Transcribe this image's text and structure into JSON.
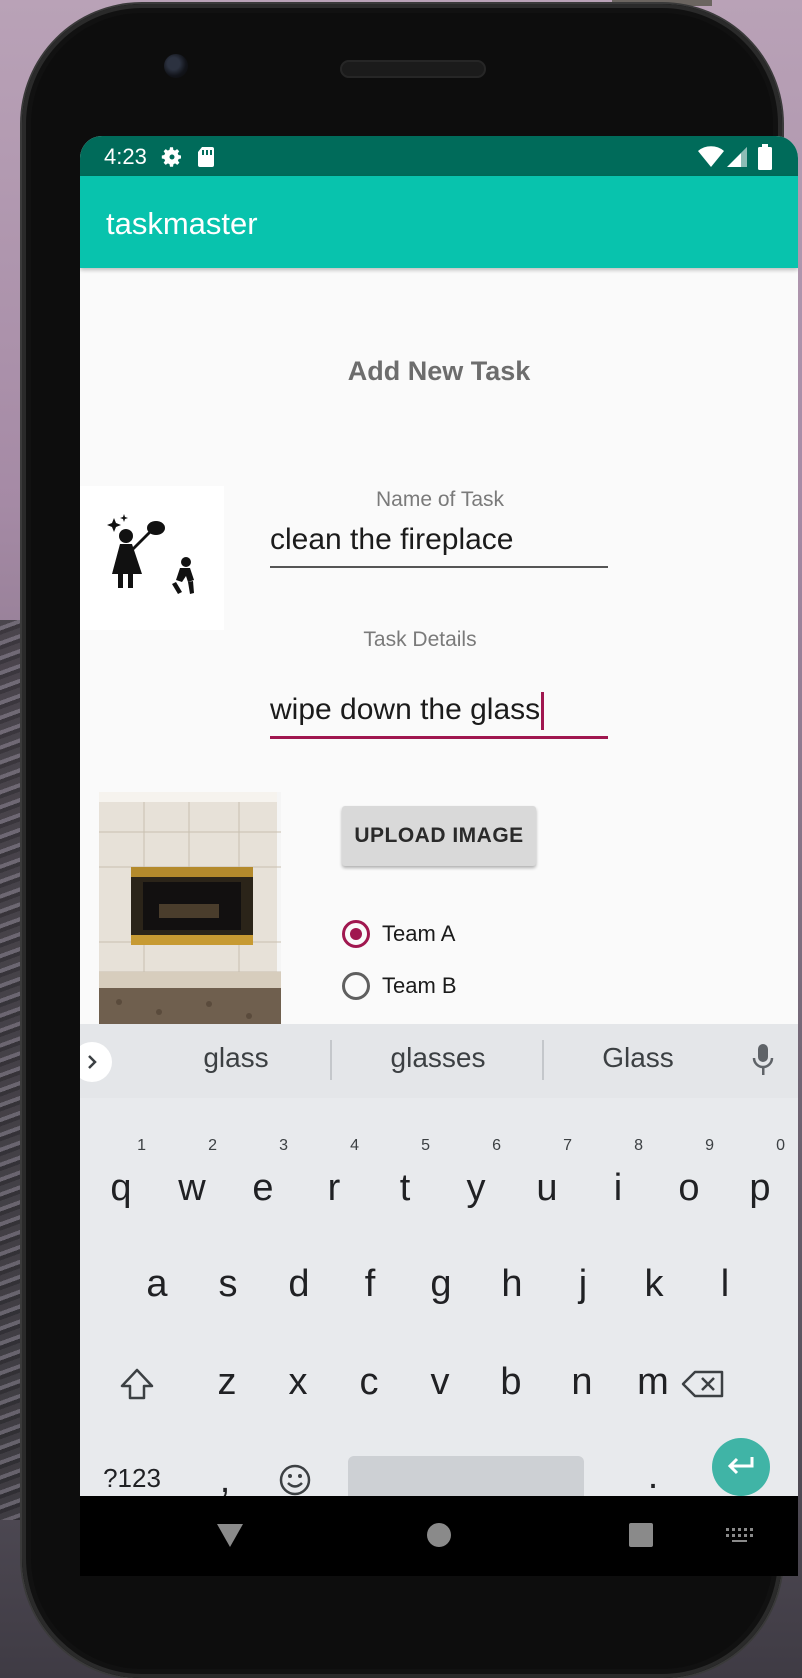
{
  "status": {
    "time": "4:23"
  },
  "app": {
    "title": "taskmaster"
  },
  "form": {
    "heading": "Add New Task",
    "name_label": "Name of Task",
    "name_value": "clean the fireplace",
    "details_label": "Task Details",
    "details_value": "wipe down the glass",
    "upload_button": "UPLOAD IMAGE",
    "teams": [
      {
        "label": "Team A",
        "checked": true
      },
      {
        "label": "Team B",
        "checked": false
      }
    ]
  },
  "keyboard": {
    "suggestions": [
      "glass",
      "glasses",
      "Glass"
    ],
    "row1": [
      {
        "key": "q",
        "hint": "1"
      },
      {
        "key": "w",
        "hint": "2"
      },
      {
        "key": "e",
        "hint": "3"
      },
      {
        "key": "r",
        "hint": "4"
      },
      {
        "key": "t",
        "hint": "5"
      },
      {
        "key": "y",
        "hint": "6"
      },
      {
        "key": "u",
        "hint": "7"
      },
      {
        "key": "i",
        "hint": "8"
      },
      {
        "key": "o",
        "hint": "9"
      },
      {
        "key": "p",
        "hint": "0"
      }
    ],
    "row2": [
      "a",
      "s",
      "d",
      "f",
      "g",
      "h",
      "j",
      "k",
      "l"
    ],
    "row3": [
      "z",
      "x",
      "c",
      "v",
      "b",
      "n",
      "m"
    ],
    "symbols_key": "?123",
    "comma_key": ",",
    "period_key": "."
  },
  "colors": {
    "statusbar": "#006b5a",
    "appbar": "#08c3ad",
    "accent": "#a0174f",
    "enter_key": "#40b4a6"
  },
  "icons": {
    "status": [
      "settings-icon",
      "sd-card-icon",
      "wifi-icon",
      "signal-icon",
      "battery-icon"
    ],
    "nav": [
      "back-icon",
      "home-icon",
      "recents-icon",
      "keyboard-switch-icon"
    ]
  }
}
